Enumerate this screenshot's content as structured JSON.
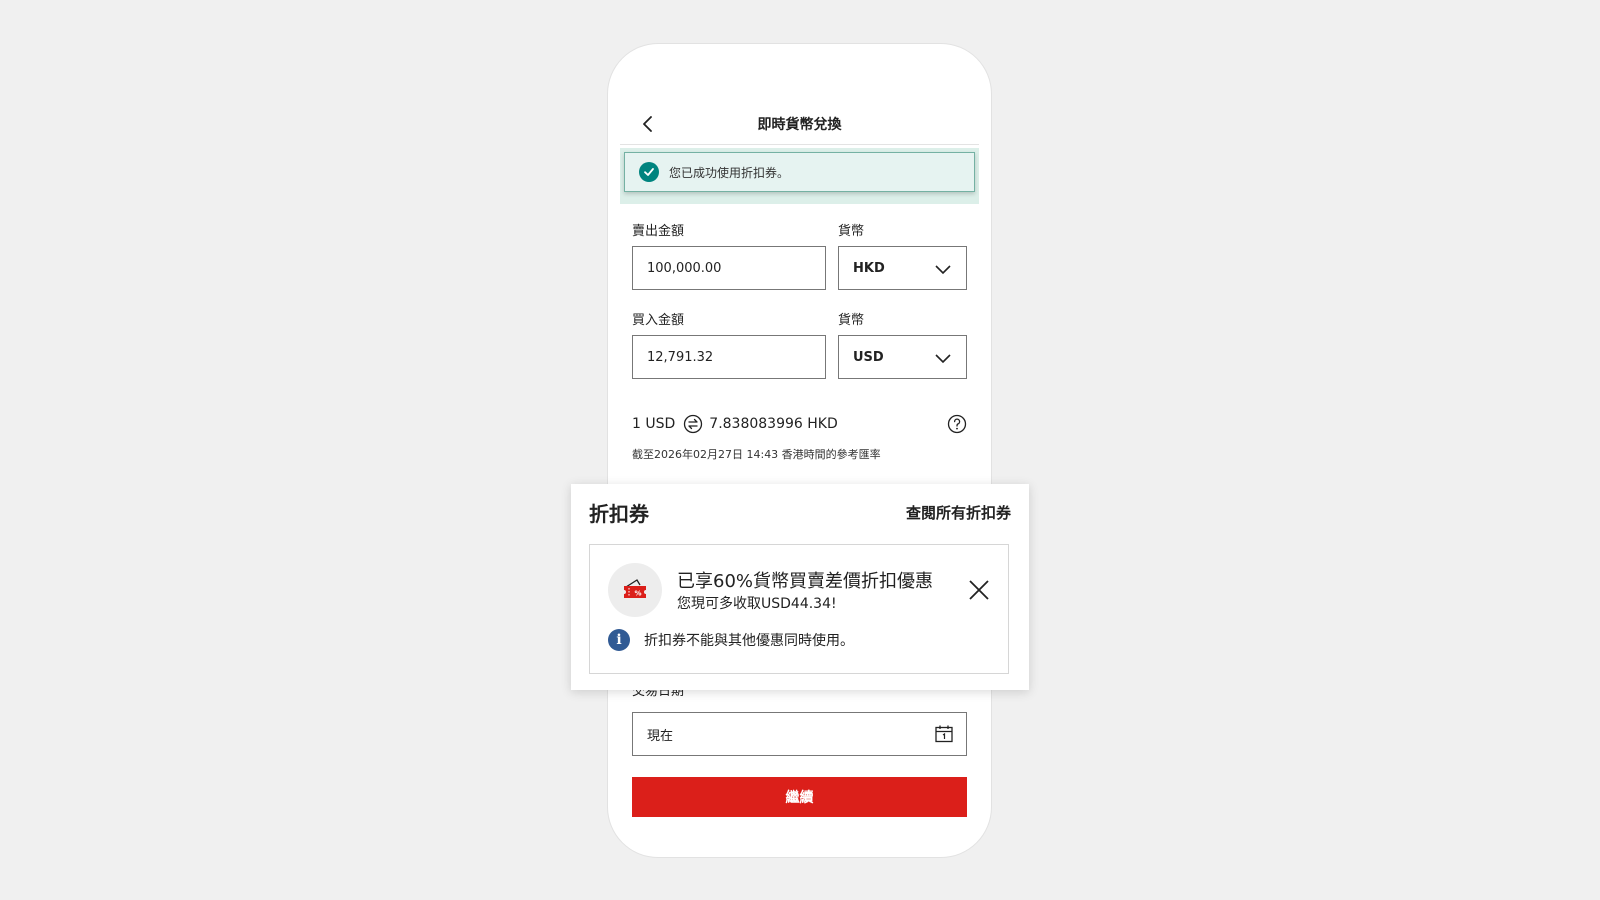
{
  "header": {
    "title": "即時貨幣兌換"
  },
  "toast": {
    "message": "您已成功使用折扣券。"
  },
  "sell": {
    "label": "賣出金額",
    "value": "100,000.00",
    "currency_label": "貨幣",
    "currency": "HKD"
  },
  "buy": {
    "label": "買入金額",
    "value": "12,791.32",
    "currency_label": "貨幣",
    "currency": "USD"
  },
  "rate": {
    "from": "1 USD",
    "to": "7.838083996 HKD",
    "note": "截至2026年02月27日 14:43 香港時間的參考匯率"
  },
  "coupon": {
    "title": "折扣券",
    "view_all": "查閱所有折扣券",
    "headline": "已享60%貨幣買賣差價折扣優惠",
    "sub": "您現可多收取USD44.34!",
    "info": "折扣券不能與其他優惠同時使用。"
  },
  "trade_date": {
    "label": "交易日期",
    "value": "現在"
  },
  "continue_label": "繼續",
  "colors": {
    "brand_red": "#db1f1a",
    "success_teal": "#00847f",
    "info_blue": "#305a94",
    "toast_bg": "#e6f3f1"
  },
  "icons": [
    "back-arrow-icon",
    "check-circle-icon",
    "chevron-down-icon",
    "swap-icon",
    "help-icon",
    "ticket-icon",
    "close-icon",
    "info-icon",
    "calendar-icon"
  ]
}
